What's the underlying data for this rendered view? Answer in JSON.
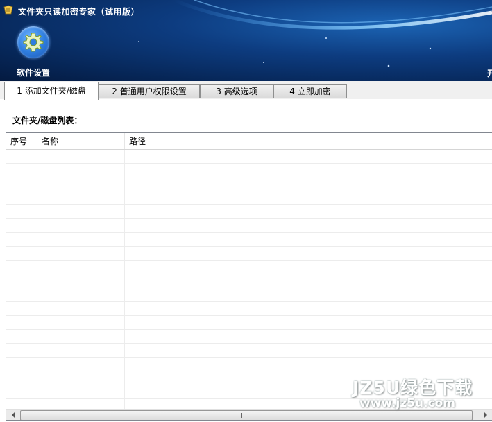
{
  "window": {
    "title": "文件夹只读加密专家（试用版）"
  },
  "toolbar": {
    "settings_label": "软件设置",
    "corner_char": "开"
  },
  "tabs": [
    {
      "label": "1 添加文件夹/磁盘",
      "active": true
    },
    {
      "label": "2 普通用户权限设置",
      "active": false
    },
    {
      "label": "3 高级选项",
      "active": false
    },
    {
      "label": "4 立即加密",
      "active": false
    }
  ],
  "panel": {
    "list_label": "文件夹/磁盘列表：",
    "columns": [
      "序号",
      "名称",
      "路径"
    ],
    "rows": []
  },
  "watermark": {
    "line1": "JZ5U绿色下载",
    "line2": "www.jz5u.com"
  },
  "colors": {
    "header_dark": "#062555",
    "header_accent": "#1c64b4"
  }
}
